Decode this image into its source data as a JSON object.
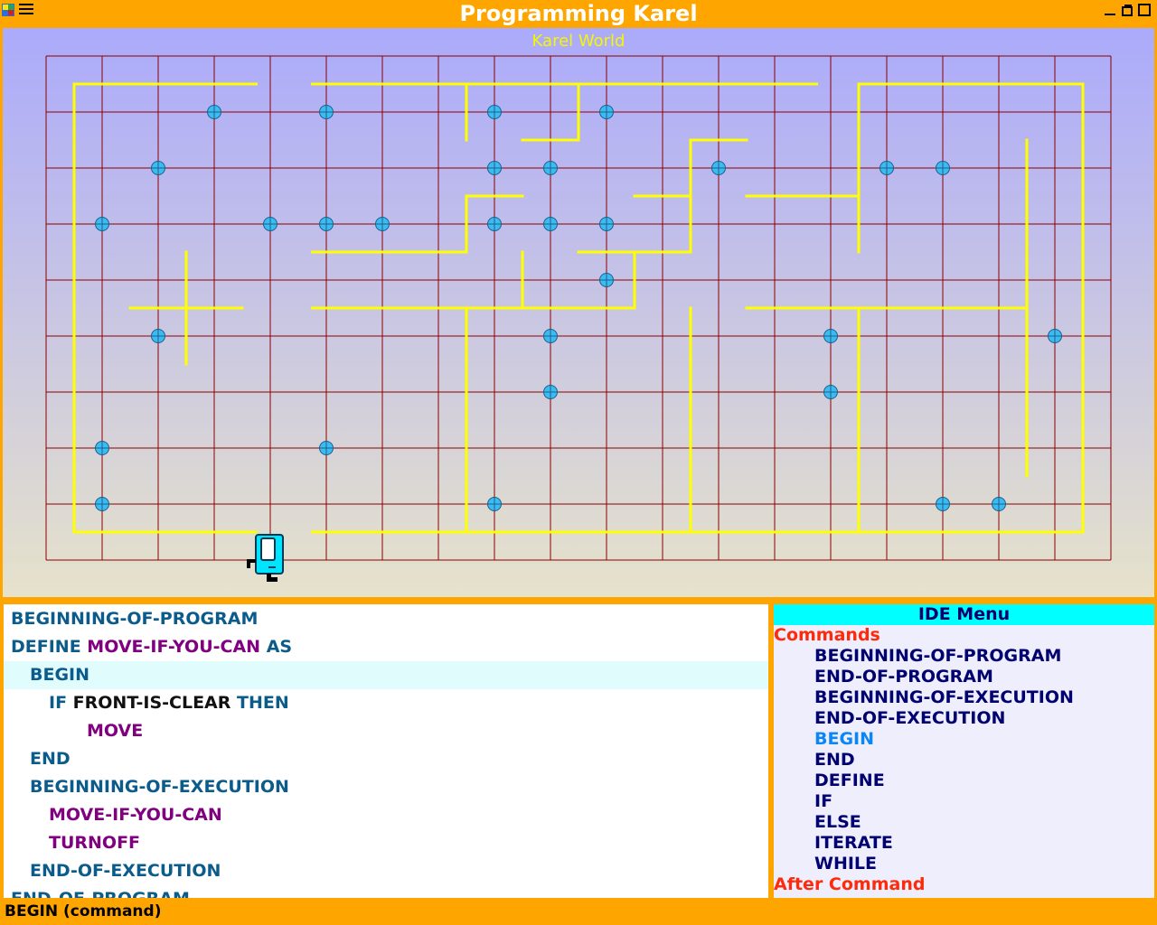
{
  "app": {
    "title": "Programming Karel"
  },
  "world": {
    "title": "Karel World",
    "colors": {
      "grid": "#8b0000",
      "wall": "#ffff00",
      "beeper": "#3bbcf0",
      "robot": "#00e5ff"
    },
    "grid": {
      "columns": 19,
      "rows": 9
    },
    "beepers": [
      [
        3,
        1
      ],
      [
        5,
        1
      ],
      [
        8,
        1
      ],
      [
        10,
        1
      ],
      [
        2,
        2
      ],
      [
        8,
        2
      ],
      [
        9,
        2
      ],
      [
        12,
        2
      ],
      [
        15,
        2
      ],
      [
        16,
        2
      ],
      [
        1,
        3
      ],
      [
        4,
        3
      ],
      [
        5,
        3
      ],
      [
        6,
        3
      ],
      [
        8,
        3
      ],
      [
        9,
        3
      ],
      [
        10,
        3
      ],
      [
        10,
        4
      ],
      [
        2,
        5
      ],
      [
        9,
        5
      ],
      [
        14,
        5
      ],
      [
        18,
        5
      ],
      [
        9,
        6
      ],
      [
        14,
        6
      ],
      [
        1,
        7
      ],
      [
        5,
        7
      ],
      [
        1,
        8
      ],
      [
        8,
        8
      ],
      [
        16,
        8
      ],
      [
        17,
        8
      ]
    ],
    "walls": [
      [
        0.5,
        0.5,
        3.75,
        0.5
      ],
      [
        4.75,
        0.5,
        13.75,
        0.5
      ],
      [
        14.5,
        0.5,
        18.5,
        0.5
      ],
      [
        0.5,
        0.5,
        0.5,
        8.5
      ],
      [
        18.5,
        0.5,
        18.5,
        8.5
      ],
      [
        0.5,
        8.5,
        3.75,
        8.5
      ],
      [
        4.75,
        8.5,
        18.5,
        8.5
      ],
      [
        7.5,
        0.5,
        7.5,
        1.5
      ],
      [
        8.5,
        1.5,
        9.5,
        1.5
      ],
      [
        9.5,
        0.5,
        9.5,
        1.5
      ],
      [
        11.5,
        1.5,
        12.5,
        1.5
      ],
      [
        11.5,
        1.5,
        11.5,
        3.5
      ],
      [
        10.5,
        2.5,
        11.5,
        2.5
      ],
      [
        12.5,
        2.5,
        14.5,
        2.5
      ],
      [
        14.5,
        0.5,
        14.5,
        3.5
      ],
      [
        7.5,
        2.5,
        8.5,
        2.5
      ],
      [
        7.5,
        2.5,
        7.5,
        3.5
      ],
      [
        4.75,
        3.5,
        7.5,
        3.5
      ],
      [
        9.5,
        3.5,
        11.5,
        3.5
      ],
      [
        10.5,
        3.5,
        10.5,
        4.5
      ],
      [
        8.5,
        3.5,
        8.5,
        4.5
      ],
      [
        4.75,
        4.5,
        10.5,
        4.5
      ],
      [
        7.5,
        4.5,
        7.5,
        8.5
      ],
      [
        1.5,
        4.5,
        3.5,
        4.5
      ],
      [
        2.5,
        3.5,
        2.5,
        5.5
      ],
      [
        11.5,
        4.5,
        11.5,
        8.5
      ],
      [
        12.5,
        4.5,
        17.5,
        4.5
      ],
      [
        14.5,
        4.5,
        14.5,
        8.5
      ],
      [
        17.5,
        1.5,
        17.5,
        7.5
      ]
    ],
    "robot": {
      "col": 4,
      "row": 9,
      "facing": "north"
    }
  },
  "editor": {
    "lines": [
      {
        "indent": 0,
        "parts": [
          {
            "t": "BEGINNING-OF-PROGRAM",
            "c": "kw"
          }
        ]
      },
      {
        "indent": 0,
        "parts": [
          {
            "t": "DEFINE ",
            "c": "kw"
          },
          {
            "t": "MOVE-IF-YOU-CAN",
            "c": "id"
          },
          {
            "t": " AS",
            "c": "kw"
          }
        ]
      },
      {
        "indent": 1,
        "highlight": true,
        "parts": [
          {
            "t": "BEGIN",
            "c": "kw"
          }
        ]
      },
      {
        "indent": 2,
        "parts": [
          {
            "t": "IF ",
            "c": "kw"
          },
          {
            "t": "FRONT-IS-CLEAR",
            "c": "cond"
          },
          {
            "t": " THEN",
            "c": "kw"
          }
        ]
      },
      {
        "indent": 4,
        "parts": [
          {
            "t": "MOVE",
            "c": "id"
          }
        ]
      },
      {
        "indent": 1,
        "parts": [
          {
            "t": "END",
            "c": "kw"
          }
        ]
      },
      {
        "indent": 1,
        "parts": [
          {
            "t": "BEGINNING-OF-EXECUTION",
            "c": "kw"
          }
        ]
      },
      {
        "indent": 2,
        "parts": [
          {
            "t": "MOVE-IF-YOU-CAN",
            "c": "id"
          }
        ]
      },
      {
        "indent": 2,
        "parts": [
          {
            "t": "TURNOFF",
            "c": "id"
          }
        ]
      },
      {
        "indent": 1,
        "parts": [
          {
            "t": "END-OF-EXECUTION",
            "c": "kw"
          }
        ]
      },
      {
        "indent": 0,
        "parts": [
          {
            "t": "END-OF-PROGRAM",
            "c": "kw"
          }
        ]
      }
    ]
  },
  "ide_menu": {
    "title": "IDE Menu",
    "commands_heading": "Commands",
    "items": [
      {
        "label": "BEGINNING-OF-PROGRAM"
      },
      {
        "label": "END-OF-PROGRAM"
      },
      {
        "label": "BEGINNING-OF-EXECUTION"
      },
      {
        "label": "END-OF-EXECUTION"
      },
      {
        "label": "BEGIN",
        "active": true
      },
      {
        "label": "END"
      },
      {
        "label": "DEFINE"
      },
      {
        "label": "IF"
      },
      {
        "label": "ELSE"
      },
      {
        "label": "ITERATE"
      },
      {
        "label": "WHILE"
      }
    ],
    "after_heading": "After Command"
  },
  "status": {
    "text": "BEGIN (command)"
  }
}
